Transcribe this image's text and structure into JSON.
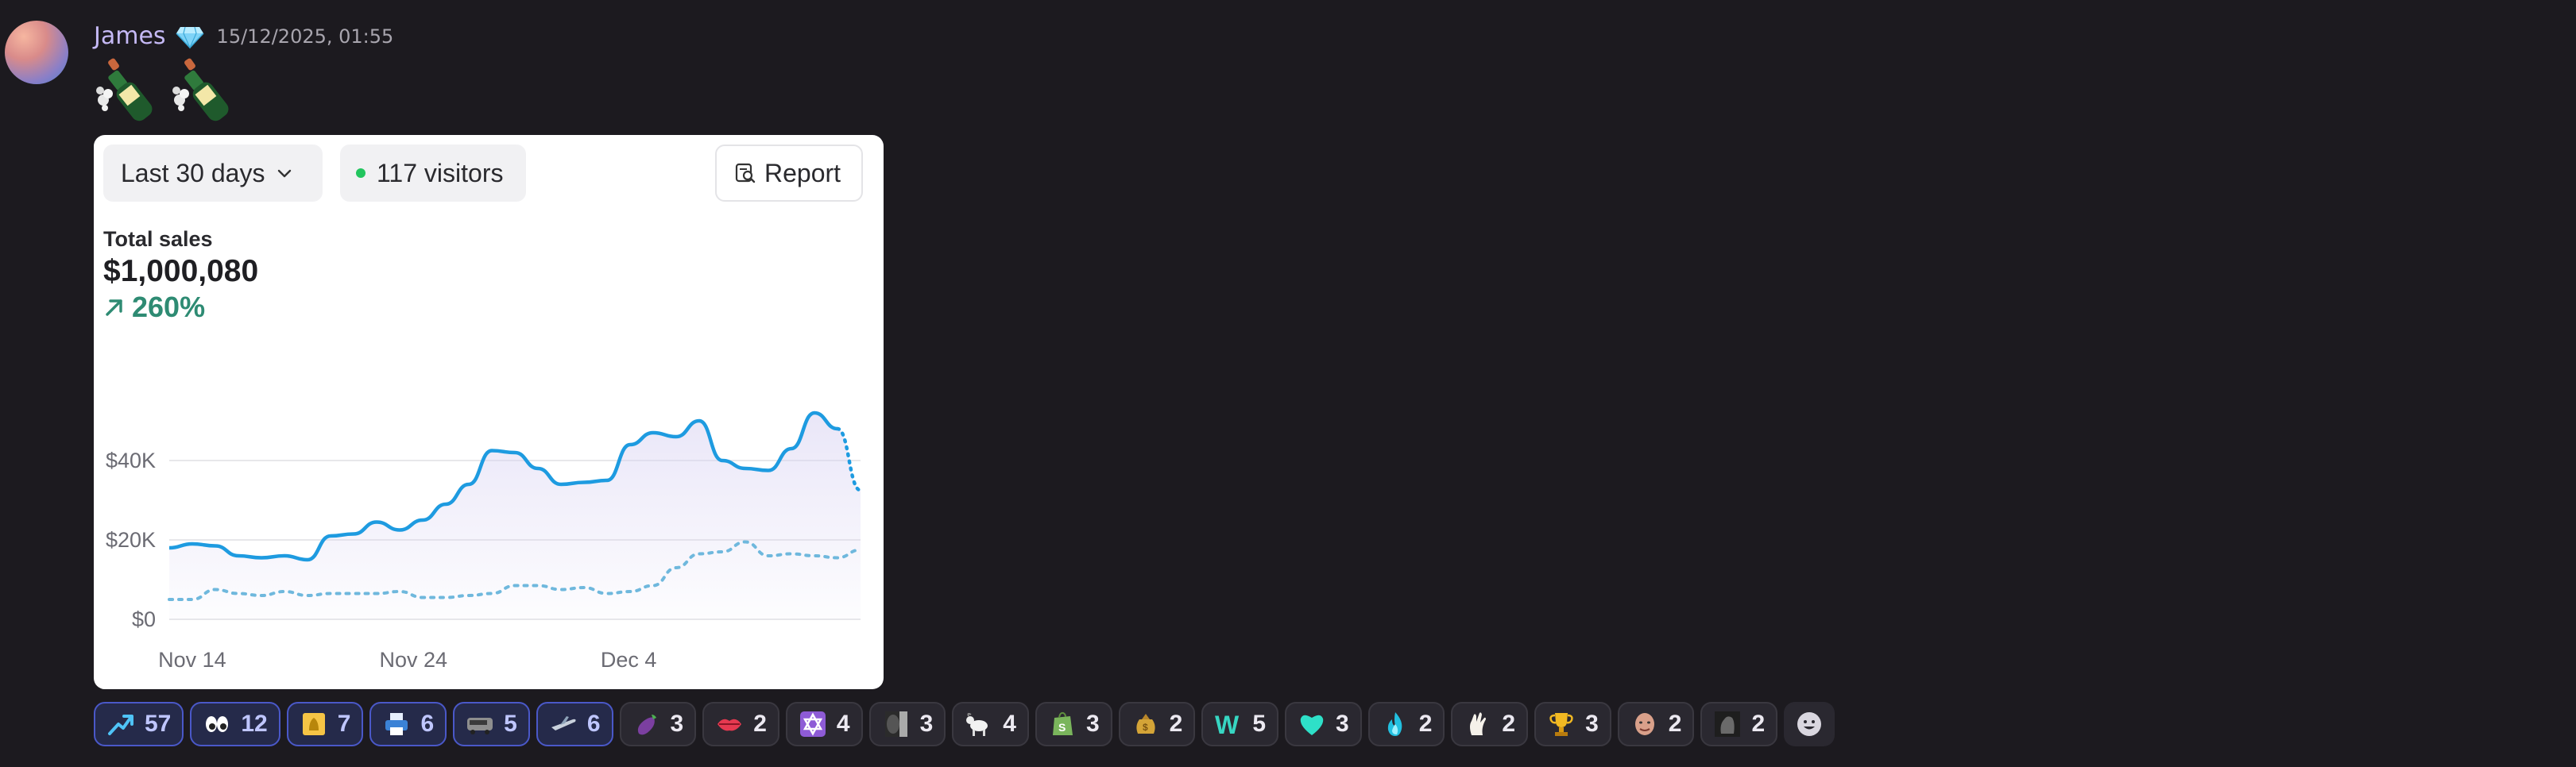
{
  "message": {
    "author": "James",
    "timestamp": "15/12/2025, 01:55",
    "badge_icon": "diamond-icon",
    "content_emojis": [
      "champagne-icon",
      "champagne-icon"
    ]
  },
  "card": {
    "range_label": "Last 30 days",
    "visitors_label": "117 visitors",
    "report_label": "Report",
    "sales_label": "Total sales",
    "sales_value": "$1,000,080",
    "sales_change": "260%",
    "accent_color": "#1e9be0",
    "change_color": "#2e8b73"
  },
  "chart_data": {
    "type": "line",
    "title": "Total sales",
    "y_ticks": [
      "$0",
      "$20K",
      "$40K"
    ],
    "x_ticks": [
      "Nov 14",
      "Nov 24",
      "Dec 4"
    ],
    "ylim": [
      0,
      54000
    ],
    "grid": true,
    "series": [
      {
        "style": "solid",
        "color": "#1e9be0",
        "values": [
          18000,
          19000,
          18500,
          16000,
          15500,
          16000,
          15000,
          21000,
          21500,
          24500,
          22500,
          25000,
          29000,
          34000,
          42500,
          42000,
          38000,
          34000,
          34500,
          35000,
          44000,
          47000,
          46000,
          50000,
          40000,
          38000,
          37500,
          43000,
          52000,
          48000,
          32500
        ]
      },
      {
        "style": "dotted",
        "color": "#6fb8dd",
        "values": [
          5000,
          5000,
          7500,
          6500,
          6000,
          7000,
          6000,
          6500,
          6500,
          6500,
          7000,
          5500,
          5500,
          6000,
          6500,
          8500,
          8500,
          7500,
          8000,
          6500,
          7000,
          8500,
          13000,
          16500,
          17000,
          19500,
          16000,
          16500,
          16000,
          15500,
          17500
        ]
      }
    ]
  },
  "reactions": [
    {
      "icon": "trending-up-icon",
      "count": "57",
      "active": true
    },
    {
      "icon": "eyes-icon",
      "count": "12",
      "active": true
    },
    {
      "icon": "gold-bag-icon",
      "count": "7",
      "active": true
    },
    {
      "icon": "printer-icon",
      "count": "6",
      "active": true
    },
    {
      "icon": "bus-icon",
      "count": "5",
      "active": true
    },
    {
      "icon": "airplane-icon",
      "count": "6",
      "active": true
    },
    {
      "icon": "eggplant-icon",
      "count": "3",
      "active": false
    },
    {
      "icon": "lips-icon",
      "count": "2",
      "active": false
    },
    {
      "icon": "star-of-david-icon",
      "count": "4",
      "active": false
    },
    {
      "icon": "shadow-face-icon",
      "count": "3",
      "active": false
    },
    {
      "icon": "goat-icon",
      "count": "4",
      "active": false
    },
    {
      "icon": "shopify-icon",
      "count": "3",
      "active": false
    },
    {
      "icon": "money-bag-icon",
      "count": "2",
      "active": false
    },
    {
      "icon": "w-letter-icon",
      "count": "5",
      "active": false
    },
    {
      "icon": "cyan-heart-icon",
      "count": "3",
      "active": false
    },
    {
      "icon": "blue-fire-icon",
      "count": "2",
      "active": false
    },
    {
      "icon": "hand-icon",
      "count": "2",
      "active": false
    },
    {
      "icon": "trophy-icon",
      "count": "3",
      "active": false
    },
    {
      "icon": "face-icon",
      "count": "2",
      "active": false
    },
    {
      "icon": "statue-icon",
      "count": "2",
      "active": false
    }
  ],
  "add_reaction_icon": "smiley-icon"
}
